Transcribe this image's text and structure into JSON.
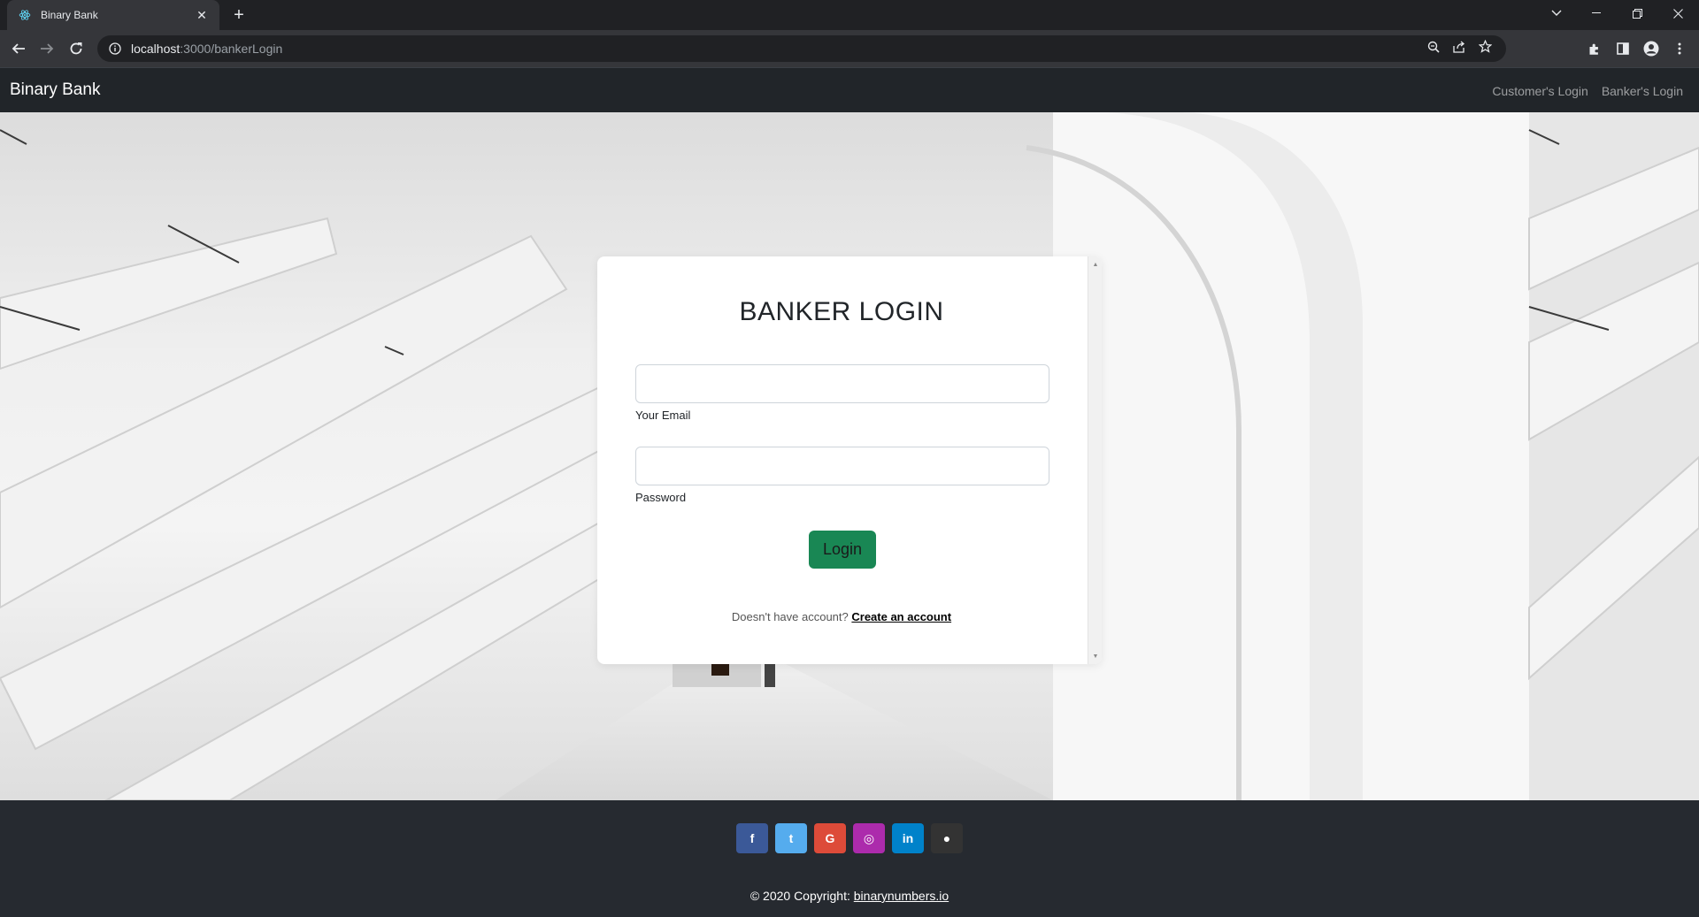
{
  "browser": {
    "tab_title": "Binary Bank",
    "new_tab_symbol": "+",
    "url_host": "localhost",
    "url_path": ":3000/bankerLogin"
  },
  "navbar": {
    "brand": "Binary Bank",
    "links": [
      "Customer's Login",
      "Banker's Login"
    ]
  },
  "login": {
    "heading": "BANKER LOGIN",
    "email_label": "Your Email",
    "email_value": "",
    "password_label": "Password",
    "password_value": "",
    "button_label": "Login",
    "signup_prompt": "Doesn't have account? ",
    "signup_link": "Create an account"
  },
  "footer": {
    "socials": [
      {
        "name": "facebook-icon",
        "glyph": "f",
        "color": "#3b5998"
      },
      {
        "name": "twitter-icon",
        "glyph": "t",
        "color": "#55acee"
      },
      {
        "name": "google-icon",
        "glyph": "G",
        "color": "#dd4b39"
      },
      {
        "name": "instagram-icon",
        "glyph": "◎",
        "color": "#ac2bac"
      },
      {
        "name": "linkedin-icon",
        "glyph": "in",
        "color": "#0082ca"
      },
      {
        "name": "github-icon",
        "glyph": "●",
        "color": "#333333"
      }
    ],
    "copyright_text": "© 2020 Copyright: ",
    "copyright_link": "binarynumbers.io"
  },
  "colors": {
    "navbar_bg": "#212529",
    "login_button": "#198754",
    "footer_bg": "#262a30"
  }
}
